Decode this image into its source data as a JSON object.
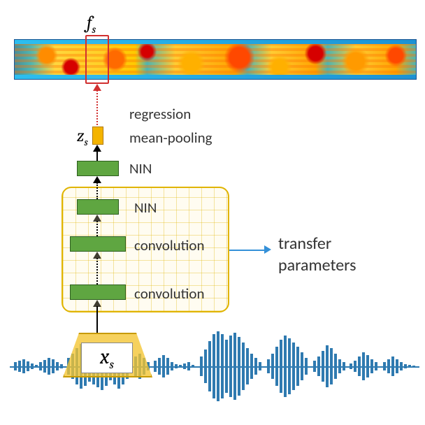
{
  "symbols": {
    "fs": "f",
    "fs_sub": "s",
    "zs": "z",
    "zs_sub": "s",
    "xs": "x",
    "xs_sub": "s"
  },
  "labels": {
    "regression": "regression",
    "mean_pooling": "mean-pooling",
    "nin_top": "NIN",
    "nin_mid": "NIN",
    "conv1": "convolution",
    "conv2": "convolution",
    "transfer_l1": "transfer",
    "transfer_l2": "parameters"
  },
  "colors": {
    "green": "#5fa641",
    "orange": "#f4b400",
    "wave": "#2f7ab0",
    "red": "#d13030",
    "arrow_blue": "#3490d8"
  }
}
